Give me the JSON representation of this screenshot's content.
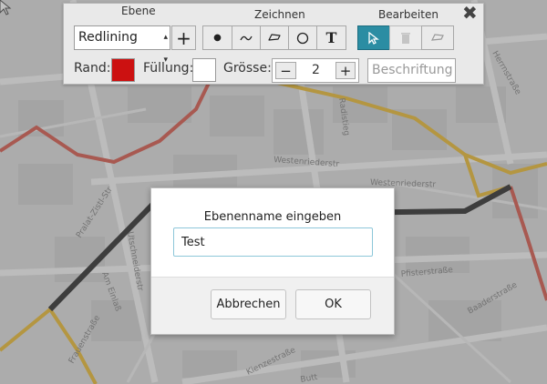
{
  "map": {
    "street_labels": [
      "Herrnstraße",
      "Radistieg",
      "Westenriederstr",
      "Westenriederstr",
      "Pralat-Zistl-Str",
      "Frauenstraße",
      "Am Einlaß",
      "Utschneiderstr",
      "Pfisterstraße",
      "Baaderstraße",
      "Kienzestraße",
      "Butt"
    ],
    "colors": {
      "black_route": "#1a1a1a",
      "orange_route": "#e7b322",
      "red_route": "#d24b3d"
    }
  },
  "toolbar": {
    "groups": {
      "ebene": "Ebene",
      "zeichnen": "Zeichnen",
      "bearbeiten": "Bearbeiten"
    },
    "layer_select": {
      "value": "Redlining"
    },
    "add_layer_icon": "plus-icon",
    "draw_tools": [
      "point-icon",
      "line-icon",
      "polygon-icon",
      "circle-icon",
      "text-icon"
    ],
    "edit_tools": [
      "select-cursor-icon",
      "delete-icon",
      "edit-shape-icon"
    ],
    "rand_label": "Rand:",
    "fuellung_label": "Füllung:",
    "groesse_label": "Grösse:",
    "size_value": "2",
    "beschriftung_placeholder": "Beschriftung",
    "border_color": "#cc1111",
    "fill_color": "#ffffff"
  },
  "dialog": {
    "title": "Ebenenname eingeben",
    "input_value": "Test",
    "cancel_label": "Abbrechen",
    "ok_label": "OK"
  }
}
